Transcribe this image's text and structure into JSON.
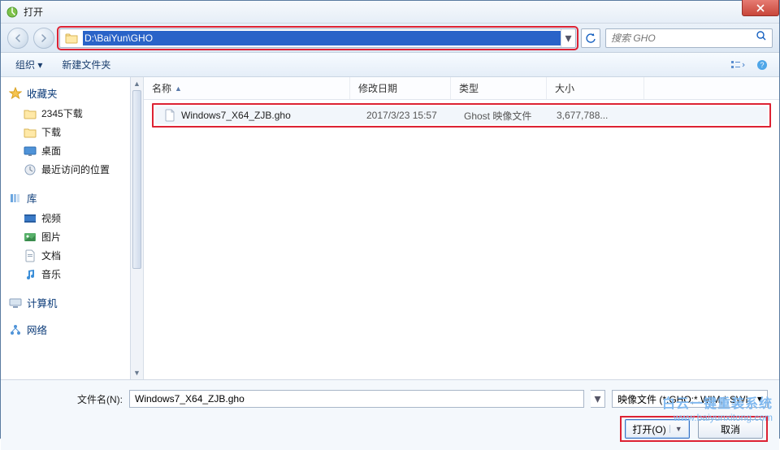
{
  "title": "打开",
  "address_path": "D:\\BaiYun\\GHO",
  "search_placeholder": "搜索 GHO",
  "toolbar": {
    "organize": "组织 ▾",
    "newfolder": "新建文件夹"
  },
  "columns": {
    "name": "名称",
    "date": "修改日期",
    "type": "类型",
    "size": "大小"
  },
  "file": {
    "name": "Windows7_X64_ZJB.gho",
    "date": "2017/3/23 15:57",
    "type": "Ghost 映像文件",
    "size": "3,677,788..."
  },
  "sidebar": {
    "fav_head": "收藏夹",
    "fav": [
      "2345下载",
      "下载",
      "桌面",
      "最近访问的位置"
    ],
    "lib_head": "库",
    "lib": [
      "视频",
      "图片",
      "文档",
      "音乐"
    ],
    "computer_head": "计算机",
    "network_head": "网络"
  },
  "filename_label": "文件名(N):",
  "filename_value": "Windows7_X64_ZJB.gho",
  "filetype_value": "映像文件 (*.GHO;*.WIM;*.SWI",
  "open_btn": "打开(O)",
  "cancel_btn": "取消",
  "watermark": {
    "l1": "白云一键重装系统",
    "l2": "www.baiyunxitong.com"
  }
}
